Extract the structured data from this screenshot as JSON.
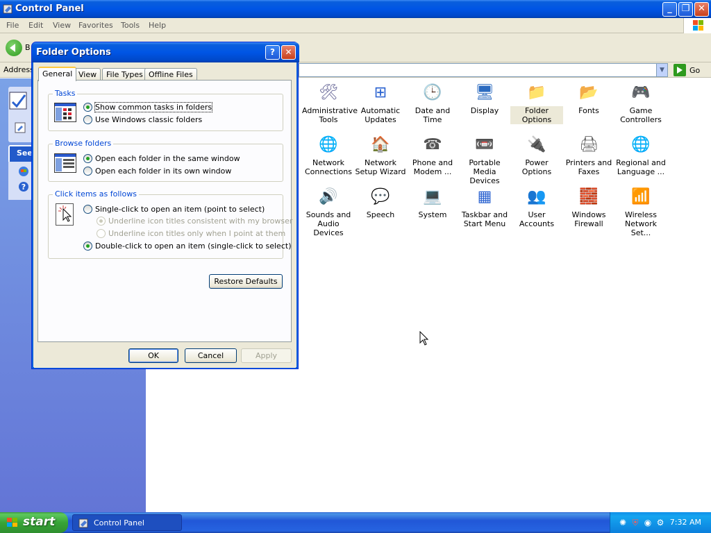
{
  "window": {
    "title": "Control Panel",
    "menu": [
      "File",
      "Edit",
      "View",
      "Favorites",
      "Tools",
      "Help"
    ],
    "toolbar_back_label": "B",
    "address_label": "Address",
    "go_label": "Go",
    "left_pane_heading": "See"
  },
  "control_panel_items": [
    {
      "label": "Administrative Tools",
      "icon": "admin-tools-icon"
    },
    {
      "label": "Automatic Updates",
      "icon": "windows-flag-icon"
    },
    {
      "label": "Date and Time",
      "icon": "clock-icon"
    },
    {
      "label": "Display",
      "icon": "display-icon"
    },
    {
      "label": "Folder Options",
      "icon": "folder-icon",
      "selected": true
    },
    {
      "label": "Fonts",
      "icon": "fonts-folder-icon"
    },
    {
      "label": "Game Controllers",
      "icon": "gamepad-icon"
    },
    {
      "label": "Network Connections",
      "icon": "globe-icon"
    },
    {
      "label": "Network Setup Wizard",
      "icon": "house-icon"
    },
    {
      "label": "Phone and Modem ...",
      "icon": "phone-icon"
    },
    {
      "label": "Portable Media Devices",
      "icon": "media-device-icon"
    },
    {
      "label": "Power Options",
      "icon": "power-icon"
    },
    {
      "label": "Printers and Faxes",
      "icon": "printer-icon"
    },
    {
      "label": "Regional and Language ...",
      "icon": "globe-icon"
    },
    {
      "label": "Sounds and Audio Devices",
      "icon": "speaker-icon"
    },
    {
      "label": "Speech",
      "icon": "speech-icon"
    },
    {
      "label": "System",
      "icon": "computer-icon"
    },
    {
      "label": "Taskbar and Start Menu",
      "icon": "taskbar-icon"
    },
    {
      "label": "User Accounts",
      "icon": "users-icon"
    },
    {
      "label": "Windows Firewall",
      "icon": "firewall-icon"
    },
    {
      "label": "Wireless Network Set...",
      "icon": "wireless-icon"
    }
  ],
  "dialog": {
    "title": "Folder Options",
    "help_glyph": "?",
    "close_glyph": "✕",
    "tabs": [
      "General",
      "View",
      "File Types",
      "Offline Files"
    ],
    "tasks": {
      "title": "Tasks",
      "options": [
        "Show common tasks in folders",
        "Use Windows classic folders"
      ],
      "selected": 0
    },
    "browse": {
      "title": "Browse folders",
      "options": [
        "Open each folder in the same window",
        "Open each folder in its own window"
      ],
      "selected": 0
    },
    "click": {
      "title": "Click items as follows",
      "single": "Single-click to open an item (point to select)",
      "underline_consistent": "Underline icon titles consistent with my browser",
      "underline_point": "Underline icon titles only when I point at them",
      "double": "Double-click to open an item (single-click to select)"
    },
    "restore_defaults": "Restore Defaults",
    "ok": "OK",
    "cancel": "Cancel",
    "apply": "Apply"
  },
  "taskbar": {
    "start_label": "start",
    "task_label": "Control Panel",
    "clock": "7:32 AM"
  }
}
